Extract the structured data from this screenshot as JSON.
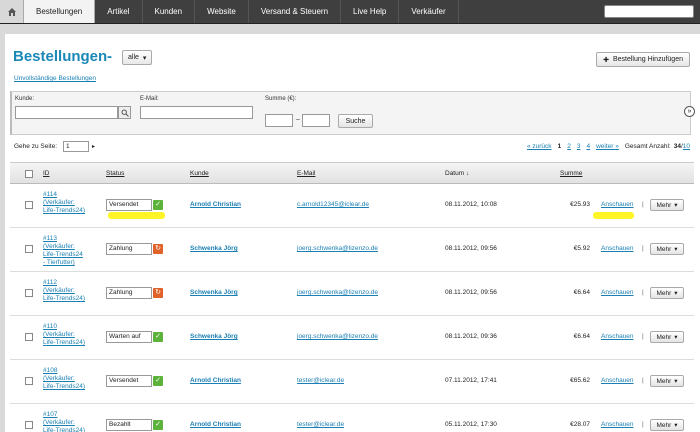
{
  "nav": {
    "tabs": [
      "Bestellungen",
      "Artikel",
      "Kunden",
      "Website",
      "Versand & Steuern",
      "Live Help",
      "Verkäufer"
    ]
  },
  "header": {
    "title": "Bestellungen",
    "dash": "-",
    "filter_value": "alle",
    "add_button": "Bestellung Hinzufügen",
    "incomplete_link": "Unvollständige Bestellungen"
  },
  "search": {
    "customer_label": "Kunde:",
    "email_label": "E-Mail:",
    "sum_label": "Summe (€):",
    "range_sep": "–",
    "button": "Suche"
  },
  "paging": {
    "goto_label": "Gehe zu Seite:",
    "goto_value": "1",
    "back": "« zurück",
    "pages": [
      "1",
      "2",
      "3",
      "4"
    ],
    "current": "1",
    "next": "weiter »",
    "total_label": "Gesamt Anzahl:",
    "total_shown": "34",
    "total_sep": "/",
    "total_all": "10"
  },
  "table": {
    "headers": {
      "id": "ID",
      "status": "Status",
      "customer": "Kunde",
      "email": "E-Mail",
      "date": "Datum ↓",
      "sum": "Summe"
    },
    "view_label": "Anschauen",
    "sep": "|",
    "more_label": "Mehr",
    "rows": [
      {
        "id": "#114\n(Verkäufer:\nLife-Trends24)",
        "status": "Versendet",
        "status_color": "green",
        "customer": "Arnold Christian",
        "email": "c.arnold12345@iclear.de",
        "date": "08.11.2012, 10:08",
        "sum": "€25.93"
      },
      {
        "id": "#113\n(Verkäufer:\nLife-Trends24\n- Tierfutter)",
        "status": "Zahlung",
        "status_color": "orange",
        "customer": "Schwenka Jörg",
        "email": "joerg.schwenka@lizenzo.de",
        "date": "08.11.2012, 09:56",
        "sum": "€5.92"
      },
      {
        "id": "#112\n(Verkäufer:\nLife-Trends24)",
        "status": "Zahlung",
        "status_color": "orange",
        "customer": "Schwenka Jörg",
        "email": "joerg.schwenka@lizenzo.de",
        "date": "08.11.2012, 09:56",
        "sum": "€6.64"
      },
      {
        "id": "#110\n(Verkäufer:\nLife-Trends24)",
        "status": "Warten auf",
        "status_color": "green",
        "customer": "Schwenka Jörg",
        "email": "joerg.schwenka@lizenzo.de",
        "date": "08.11.2012, 09:36",
        "sum": "€6.64"
      },
      {
        "id": "#108\n(Verkäufer:\nLife-Trends24)",
        "status": "Versendet",
        "status_color": "green",
        "customer": "Arnold Christian",
        "email": "tester@iclear.de",
        "date": "07.11.2012, 17:41",
        "sum": "€65.62"
      },
      {
        "id": "#107\n(Verkäufer:\nLife-Trends24)",
        "status": "Bezahlt",
        "status_color": "green",
        "customer": "Arnold Christian",
        "email": "tester@iclear.de",
        "date": "05.11.2012, 17:30",
        "sum": "€28.07"
      }
    ]
  },
  "colors": {
    "accent": "#1b88b8",
    "nav_bg": "#3f3f3f",
    "highlight": "#fff200"
  }
}
